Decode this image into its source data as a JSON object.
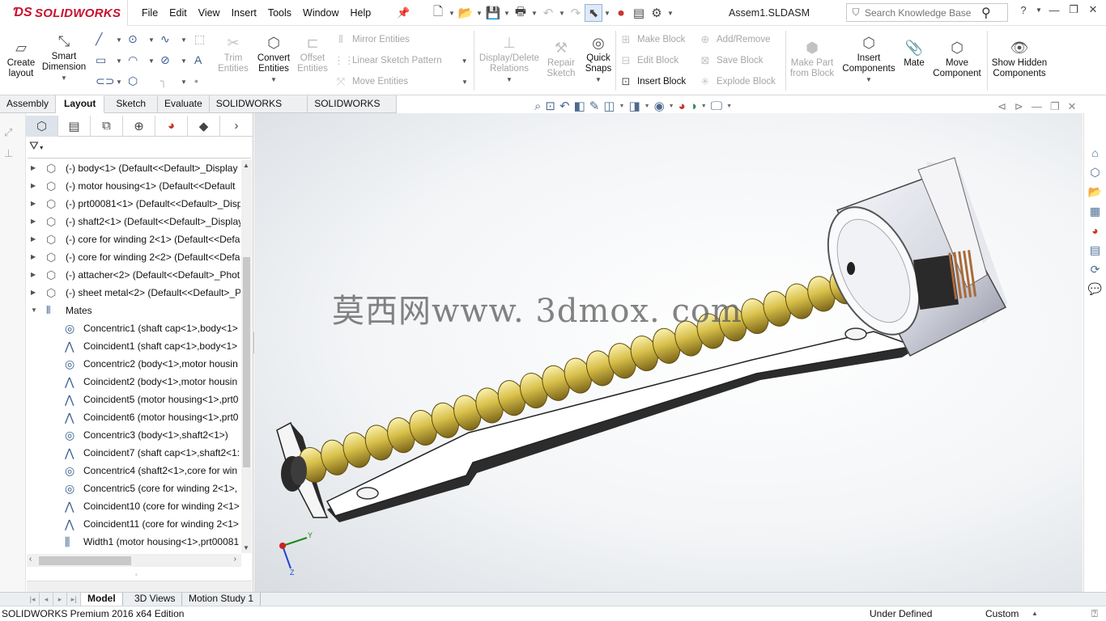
{
  "app": {
    "brand": "SOLIDWORKS",
    "document_title": "Assem1.SLDASM"
  },
  "menu": [
    "File",
    "Edit",
    "View",
    "Insert",
    "Tools",
    "Window",
    "Help"
  ],
  "search": {
    "placeholder": "Search Knowledge Base"
  },
  "ribbon": {
    "create_layout": "Create layout",
    "smart_dimension": "Smart Dimension",
    "trim_entities": "Trim Entities",
    "convert_entities": "Convert Entities",
    "offset_entities": "Offset Entities",
    "mirror_entities": "Mirror Entities",
    "linear_sketch_pattern": "Linear Sketch Pattern",
    "move_entities": "Move Entities",
    "display_delete_relations": "Display/Delete Relations",
    "repair_sketch": "Repair Sketch",
    "quick_snaps": "Quick Snaps",
    "make_block": "Make Block",
    "edit_block": "Edit Block",
    "insert_block": "Insert Block",
    "add_remove": "Add/Remove",
    "save_block": "Save Block",
    "explode_block": "Explode Block",
    "make_part_from_block": "Make Part from Block",
    "insert_components": "Insert Components",
    "mate": "Mate",
    "move_component": "Move Component",
    "show_hidden_components": "Show Hidden Components"
  },
  "tabs": [
    "Assembly",
    "Layout",
    "Sketch",
    "Evaluate",
    "SOLIDWORKS Add-Ins",
    "SOLIDWORKS MBD"
  ],
  "active_tab": "Layout",
  "tree": {
    "components": [
      "(-) body<1> (Default<<Default>_Display",
      "(-) motor housing<1> (Default<<Default",
      "(-) prt00081<1> (Default<<Default>_Disp",
      "(-) shaft2<1> (Default<<Default>_Display",
      "(-) core for winding 2<1> (Default<<Defa",
      "(-) core for winding 2<2> (Default<<Defa",
      "(-) attacher<2> (Default<<Default>_Phot",
      "(-) sheet metal<2> (Default<<Default>_P"
    ],
    "mates_label": "Mates",
    "mates": [
      "Concentric1 (shaft cap<1>,body<1>",
      "Coincident1 (shaft cap<1>,body<1>",
      "Concentric2 (body<1>,motor housin",
      "Coincident2 (body<1>,motor housin",
      "Coincident5 (motor housing<1>,prt0",
      "Coincident6 (motor housing<1>,prt0",
      "Concentric3 (body<1>,shaft2<1>)",
      "Coincident7 (shaft cap<1>,shaft2<1:",
      "Concentric4 (shaft2<1>,core for win",
      "Concentric5 (core for winding 2<1>,",
      "Coincident10 (core for winding 2<1>",
      "Coincident11 (core for winding 2<1>",
      "Width1 (motor housing<1>,prt00081"
    ],
    "mate_types": [
      "concentric",
      "coincident",
      "concentric",
      "coincident",
      "coincident",
      "coincident",
      "concentric",
      "coincident",
      "concentric",
      "concentric",
      "coincident",
      "coincident",
      "width"
    ]
  },
  "watermark": "莫西网www. 3dmox. com",
  "triad": {
    "y": "Y",
    "z": "Z"
  },
  "bottom_tabs": [
    "Model",
    "3D Views",
    "Motion Study 1"
  ],
  "status": {
    "edition": "SOLIDWORKS Premium 2016 x64 Edition",
    "state": "Under Defined",
    "units": "Custom"
  },
  "colors": {
    "brand_red": "#c8102e",
    "screw_gold": "#d8c04a",
    "accent_blue": "#3a6fb0"
  }
}
